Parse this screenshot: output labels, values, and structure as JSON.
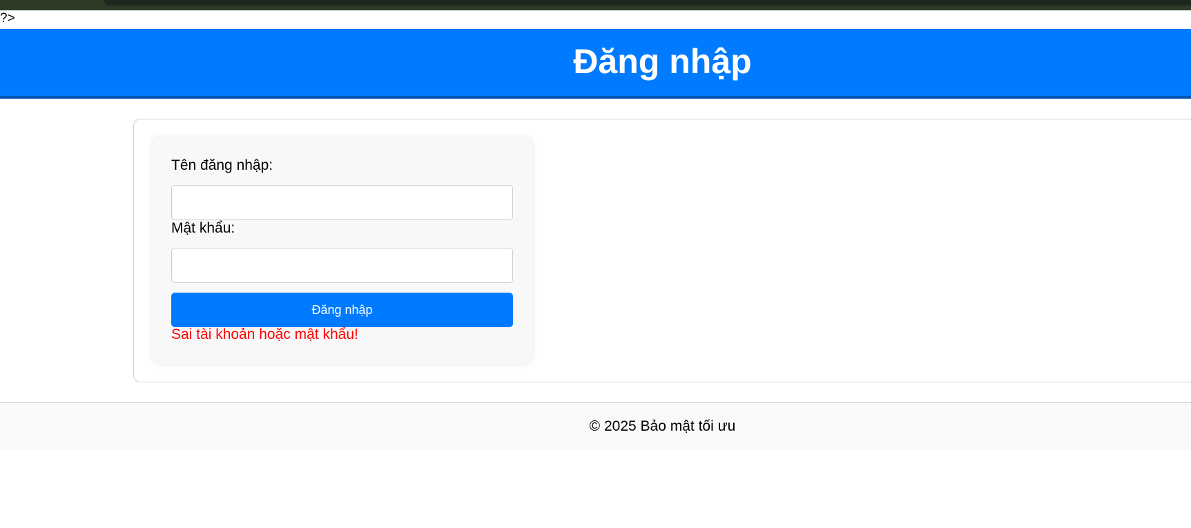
{
  "stray_text": "?>",
  "header": {
    "title": "Đăng nhập"
  },
  "login_form": {
    "username_label": "Tên đăng nhập:",
    "username_value": "",
    "password_label": "Mật khẩu:",
    "password_value": "",
    "submit_label": "Đăng nhập",
    "error_message": "Sai tài khoản hoặc mật khẩu!"
  },
  "footer": {
    "text": "© 2025 Bảo mật tối ưu"
  },
  "colors": {
    "header_bg": "#007bff",
    "header_border": "#0056b3",
    "button_bg": "#007bff",
    "error_text": "#ff0000",
    "footer_bg": "#f8f9fa"
  }
}
